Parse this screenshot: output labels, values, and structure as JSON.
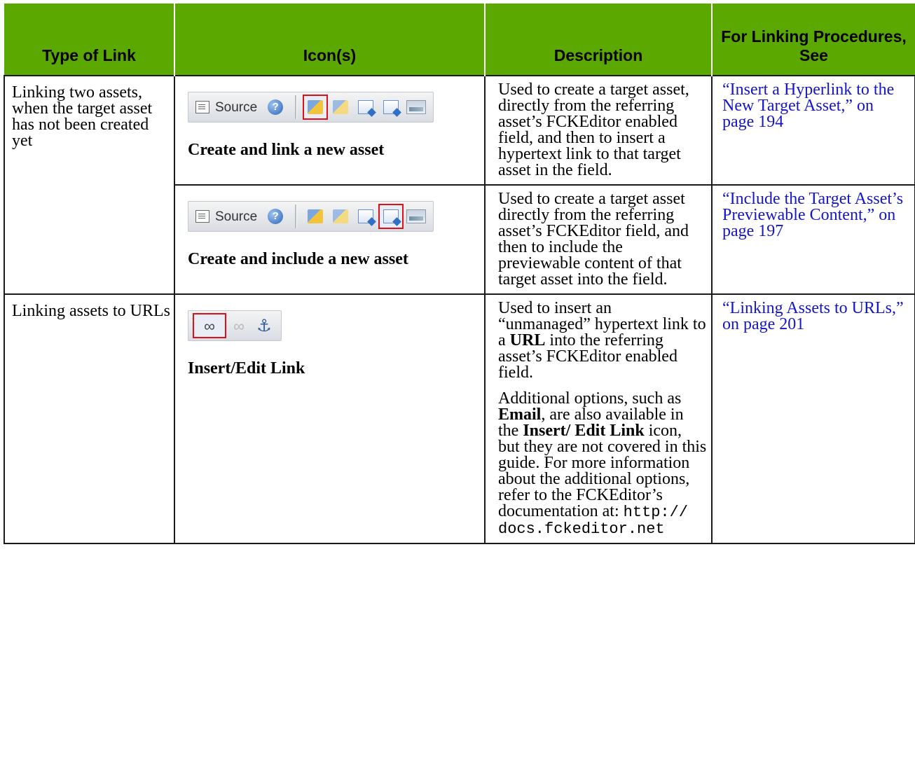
{
  "header": {
    "col1": "Type of Link",
    "col2": "Icon(s)",
    "col3": "Description",
    "col4": "For Linking Procedures, See"
  },
  "toolbar": {
    "source_label": "Source"
  },
  "rows": [
    {
      "type": "Linking two assets, when the target asset has not been created yet",
      "caption": "Create and link a new asset",
      "description": "Used to create a target asset, directly from the referring asset’s FCKEditor enabled field, and then to insert a hypertext link to that target asset in the field.",
      "see": "“Insert a Hyperlink to the New Target Asset,” on page 194"
    },
    {
      "type": "",
      "caption": "Create and include a new asset",
      "description": "Used to create a target asset directly from the referring asset’s FCKEditor field, and then to include the previewable content of that target asset into the field.",
      "see": "“Include the Target Asset’s Previewable Content,” on page 197"
    },
    {
      "type": "Linking assets to URLs",
      "caption": "Insert/Edit Link",
      "description": {
        "p1_a": "Used to insert an “unmanaged” hypertext link to a ",
        "p1_b": "URL",
        "p1_c": " into the referring asset’s FCKEditor enabled field.",
        "p2_a": "Additional options, such as ",
        "p2_b": "Email",
        "p2_c": ", are also available in the ",
        "p2_d": "Insert/ Edit Link",
        "p2_e": " icon, but they are not covered in this guide. For more information about the additional options, refer to the FCKEditor’s documentation at: ",
        "p2_url": "http:// docs.fckeditor.net"
      },
      "see": "“Linking Assets to URLs,” on page 201"
    }
  ],
  "colors": {
    "header_bg": "#5aa800",
    "link_text": "#1515cc",
    "highlight_box": "#e0101a"
  },
  "icons": [
    "source-icon",
    "help-icon",
    "create-link-asset-icon",
    "edit-link-asset-icon",
    "create-include-asset-icon",
    "include-asset-icon",
    "image-asset-icon",
    "link-icon",
    "unlink-icon",
    "anchor-icon"
  ]
}
